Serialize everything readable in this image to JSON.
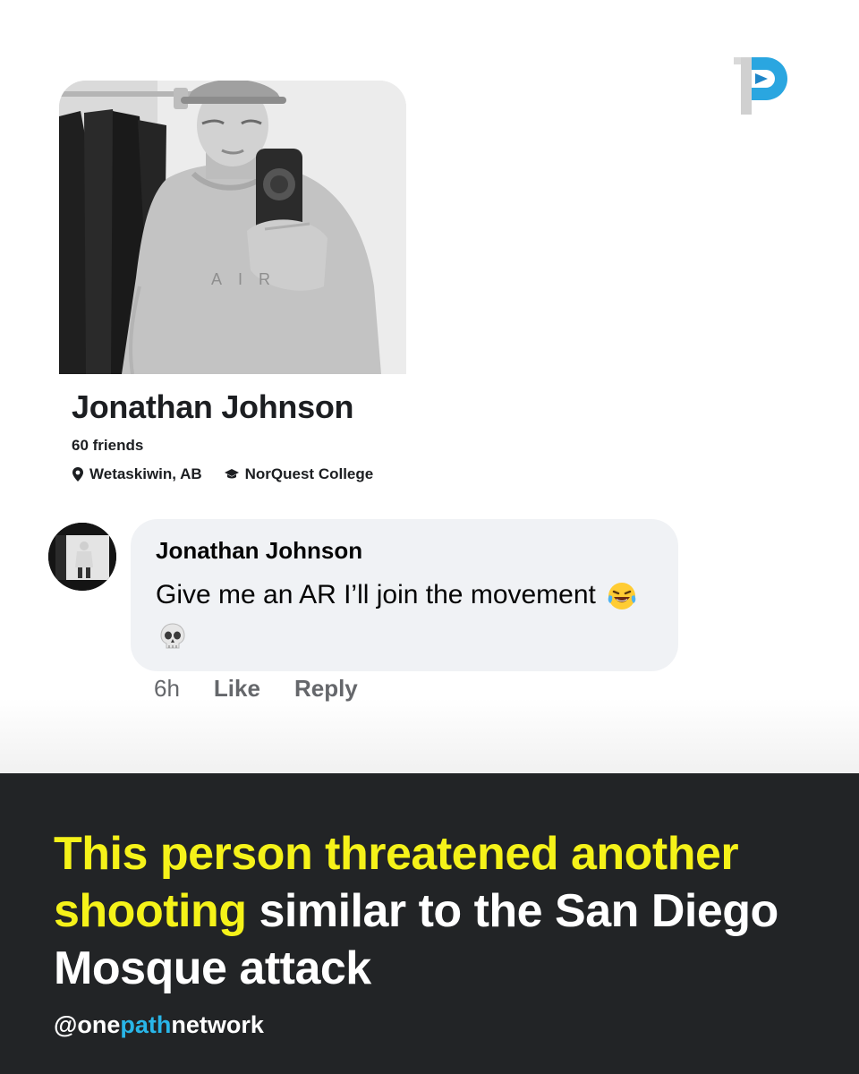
{
  "brand": {
    "logo_icon": "onepath-p-logo-icon",
    "handle_prefix": "@one",
    "handle_highlight": "path",
    "handle_suffix": "network",
    "accent_color": "#29b6e8"
  },
  "profile": {
    "name": "Jonathan Johnson",
    "friends": "60 friends",
    "location": "Wetaskiwin, AB",
    "school": "NorQuest College",
    "location_icon": "map-pin-icon",
    "school_icon": "graduation-cap-icon",
    "shirt_text": "AIR"
  },
  "comment": {
    "author": "Jonathan Johnson",
    "text": "Give me an AR I’ll join the movement",
    "emojis": [
      "laughing-crying-emoji",
      "skull-emoji"
    ],
    "time": "6h",
    "like_label": "Like",
    "reply_label": "Reply"
  },
  "banner": {
    "headline_highlight": "This person threatened another shooting",
    "headline_rest": " similar to the San Diego Mosque attack",
    "highlight_color": "#f5f219",
    "background_color": "#222426"
  }
}
